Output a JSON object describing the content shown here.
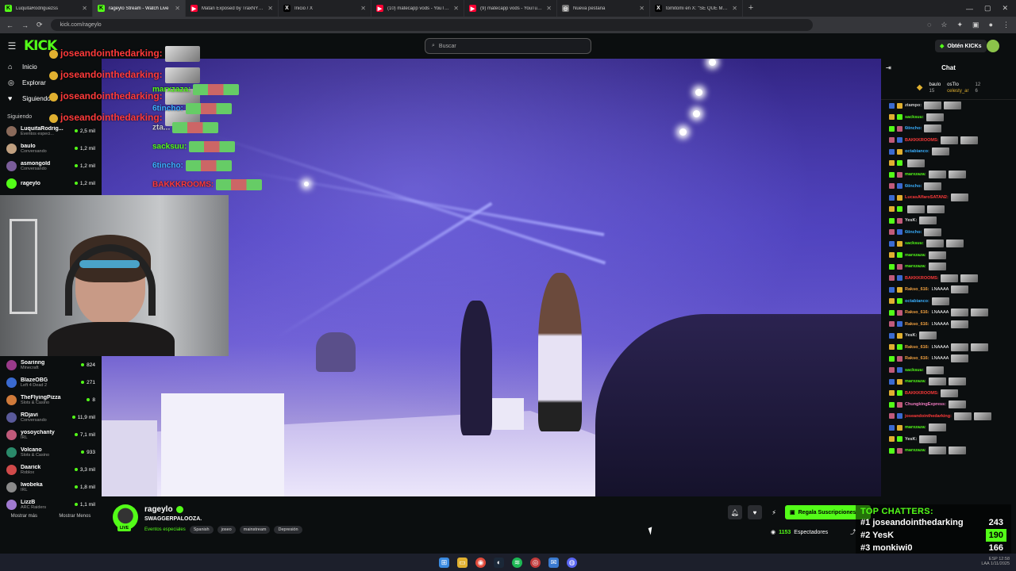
{
  "browser": {
    "tabs": [
      {
        "title": "LuquitaRodriguezss",
        "icon": "kick-icon"
      },
      {
        "title": "rageylo Stream - Watch Live",
        "icon": "kick-icon",
        "active": true
      },
      {
        "title": "Matan Exposed by TraxNYC - YouTube",
        "icon": "youtube-icon"
      },
      {
        "title": "Inicio / X",
        "icon": "x-icon"
      },
      {
        "title": "(10) matecapp vods - YouTube",
        "icon": "youtube-icon"
      },
      {
        "title": "(9) matecapp vods - YouTube",
        "icon": "youtube-icon"
      },
      {
        "title": "Nueva pestaña",
        "icon": "globe-icon"
      },
      {
        "title": "tomitomi en X: \"SE QUE ME FA",
        "icon": "x-icon"
      }
    ],
    "url": "kick.com/rageylo"
  },
  "header": {
    "logo": "KICK",
    "search_placeholder": "Buscar",
    "get_kicks": "Obtén KICKs"
  },
  "sidebar": {
    "nav": [
      {
        "label": "Inicio",
        "icon": "home-icon"
      },
      {
        "label": "Explorar",
        "icon": "compass-icon"
      },
      {
        "label": "Siguiendo",
        "icon": "heart-icon"
      }
    ],
    "following_label": "Siguiendo",
    "following": [
      {
        "name": "LuquitaRodrig...",
        "game": "Eventos especi...",
        "viewers": "2,5 mil",
        "color": "#8a6a5a"
      },
      {
        "name": "baulo",
        "game": "Conversando",
        "viewers": "1,2 mil",
        "color": "#c0a080"
      },
      {
        "name": "asmongold",
        "game": "Conversando",
        "viewers": "1,2 mil",
        "color": "#7a5d9a"
      },
      {
        "name": "rageylo",
        "game": "",
        "viewers": "1,2 mil",
        "color": "#53fc18"
      }
    ],
    "recommended": [
      {
        "name": "Soarinng",
        "game": "Minecraft",
        "viewers": "824",
        "color": "#9a3a8a"
      },
      {
        "name": "BlazeOBG",
        "game": "Left 4 Dead 2",
        "viewers": "271",
        "color": "#3a6ad0"
      },
      {
        "name": "TheFlyingPizza",
        "game": "Slots & Casino",
        "viewers": "8",
        "color": "#d07a3a"
      },
      {
        "name": "RDjavi",
        "game": "Conversando",
        "viewers": "11,9 mil",
        "color": "#5a5a9a"
      },
      {
        "name": "yosoychanty",
        "game": "IRL",
        "viewers": "7,1 mil",
        "color": "#c05a7a"
      },
      {
        "name": "Volcano",
        "game": "Slots & Casino",
        "viewers": "933",
        "color": "#2a8a6a"
      },
      {
        "name": "Daarick",
        "game": "Roblox",
        "viewers": "3,3 mil",
        "color": "#d04a4a"
      },
      {
        "name": "Iwobeka",
        "game": "IRL",
        "viewers": "1,8 mil",
        "color": "#8a8a8a"
      },
      {
        "name": "LizzB",
        "game": "ARC Raiders",
        "viewers": "1,1 mil",
        "color": "#a07ad0"
      }
    ],
    "show_more": "Mostrar más",
    "show_less": "Mostrar Menos"
  },
  "overlay": [
    {
      "user": "joseandointhedarking:",
      "cls": "ovl-red"
    },
    {
      "user": "joseandointhedarking:",
      "cls": "ovl-red"
    },
    {
      "user": "joseandointhedarking:",
      "cls": "ovl-red"
    },
    {
      "user": "joseandointhedarking:",
      "cls": "ovl-red"
    }
  ],
  "overlay_mid": [
    {
      "user": "marxzaza:",
      "color": "#53fc18"
    },
    {
      "user": "6tincho:",
      "color": "#3ab0ff"
    },
    {
      "user": "zta...",
      "color": "#ccc"
    },
    {
      "user": "sacksuu:",
      "color": "#53fc18"
    },
    {
      "user": "6tincho:",
      "color": "#3ab0ff"
    },
    {
      "user": "BAKKKROOMS:",
      "color": "#ff3a3a"
    }
  ],
  "chat": {
    "title": "Chat",
    "podium": [
      {
        "name": "baulo",
        "count": "12"
      },
      {
        "name": "osTlo",
        "count": ""
      },
      {
        "name": "celesty_ar",
        "count": "6"
      }
    ],
    "podium_left": "15",
    "messages": [
      {
        "user": "ztampo:",
        "color": "#ccc",
        "text": ""
      },
      {
        "user": "sacksuu:",
        "color": "#53fc18",
        "text": ""
      },
      {
        "user": "6tincho:",
        "color": "#3ab0ff",
        "text": ""
      },
      {
        "user": "BAKKKROOMS:",
        "color": "#ff3a3a",
        "text": ""
      },
      {
        "user": "octabianco:",
        "color": "#3ab0ff",
        "text": ""
      },
      {
        "user": "",
        "color": "#ccc",
        "text": ""
      },
      {
        "user": "marxzaza:",
        "color": "#53fc18",
        "text": ""
      },
      {
        "user": "6tincho:",
        "color": "#3ab0ff",
        "text": ""
      },
      {
        "user": "LucasAlfaroSATAN2:",
        "color": "#ff3a3a",
        "text": ""
      },
      {
        "user": "",
        "color": "#ccc",
        "text": ""
      },
      {
        "user": "YesK:",
        "color": "#ddd",
        "text": ""
      },
      {
        "user": "6tincho:",
        "color": "#3ab0ff",
        "text": ""
      },
      {
        "user": "sacksuu:",
        "color": "#53fc18",
        "text": ""
      },
      {
        "user": "marxzaza:",
        "color": "#53fc18",
        "text": ""
      },
      {
        "user": "marxzaza:",
        "color": "#53fc18",
        "text": ""
      },
      {
        "user": "BAKKKROOMS:",
        "color": "#ff3a3a",
        "text": ""
      },
      {
        "user": "Rakso_616:",
        "color": "#f0a040",
        "text": "LNAAAA"
      },
      {
        "user": "octabianco:",
        "color": "#3ab0ff",
        "text": ""
      },
      {
        "user": "Rakso_616:",
        "color": "#f0a040",
        "text": "LNAAAA"
      },
      {
        "user": "Rakso_616:",
        "color": "#f0a040",
        "text": "LNAAAA"
      },
      {
        "user": "YesK:",
        "color": "#ddd",
        "text": ""
      },
      {
        "user": "Rakso_616:",
        "color": "#f0a040",
        "text": "LNAAAA"
      },
      {
        "user": "Rakso_616:",
        "color": "#f0a040",
        "text": "LNAAAA"
      },
      {
        "user": "sacksuu:",
        "color": "#53fc18",
        "text": ""
      },
      {
        "user": "marxzaza:",
        "color": "#53fc18",
        "text": ""
      },
      {
        "user": "BAKKKROOMS:",
        "color": "#ff3a3a",
        "text": ""
      },
      {
        "user": "ChungkingExpress:",
        "color": "#f07ac0",
        "text": ""
      },
      {
        "user": "joseandointhedarking:",
        "color": "#ff3a3a",
        "text": ""
      },
      {
        "user": "marxzaza:",
        "color": "#53fc18",
        "text": ""
      },
      {
        "user": "YesK:",
        "color": "#ddd",
        "text": ""
      },
      {
        "user": "marxzaza:",
        "color": "#53fc18",
        "text": ""
      }
    ]
  },
  "stream": {
    "name": "rageylo",
    "live": "LIVE",
    "title": "SWAGGERPALOOZA.",
    "category": "Eventos especiales",
    "tags": [
      "Spanish",
      "joseo",
      "mainstream",
      "Depresión"
    ],
    "subscribe": "Regala Suscripciones",
    "viewers": "1153",
    "viewers_label": "Espectadores"
  },
  "top_chatters": {
    "title": "TOP CHATTERS:",
    "rows": [
      {
        "rank": "#1",
        "name": "joseandointhedarking",
        "count": "243",
        "hl": false
      },
      {
        "rank": "#2",
        "name": "YesK",
        "count": "190",
        "hl": true
      },
      {
        "rank": "#3",
        "name": "monkiwi0",
        "count": "166",
        "hl": false
      }
    ]
  },
  "tray": {
    "lang": "ESP",
    "lang2": "LAA",
    "time": "12:58",
    "date": "1/11/2025"
  }
}
